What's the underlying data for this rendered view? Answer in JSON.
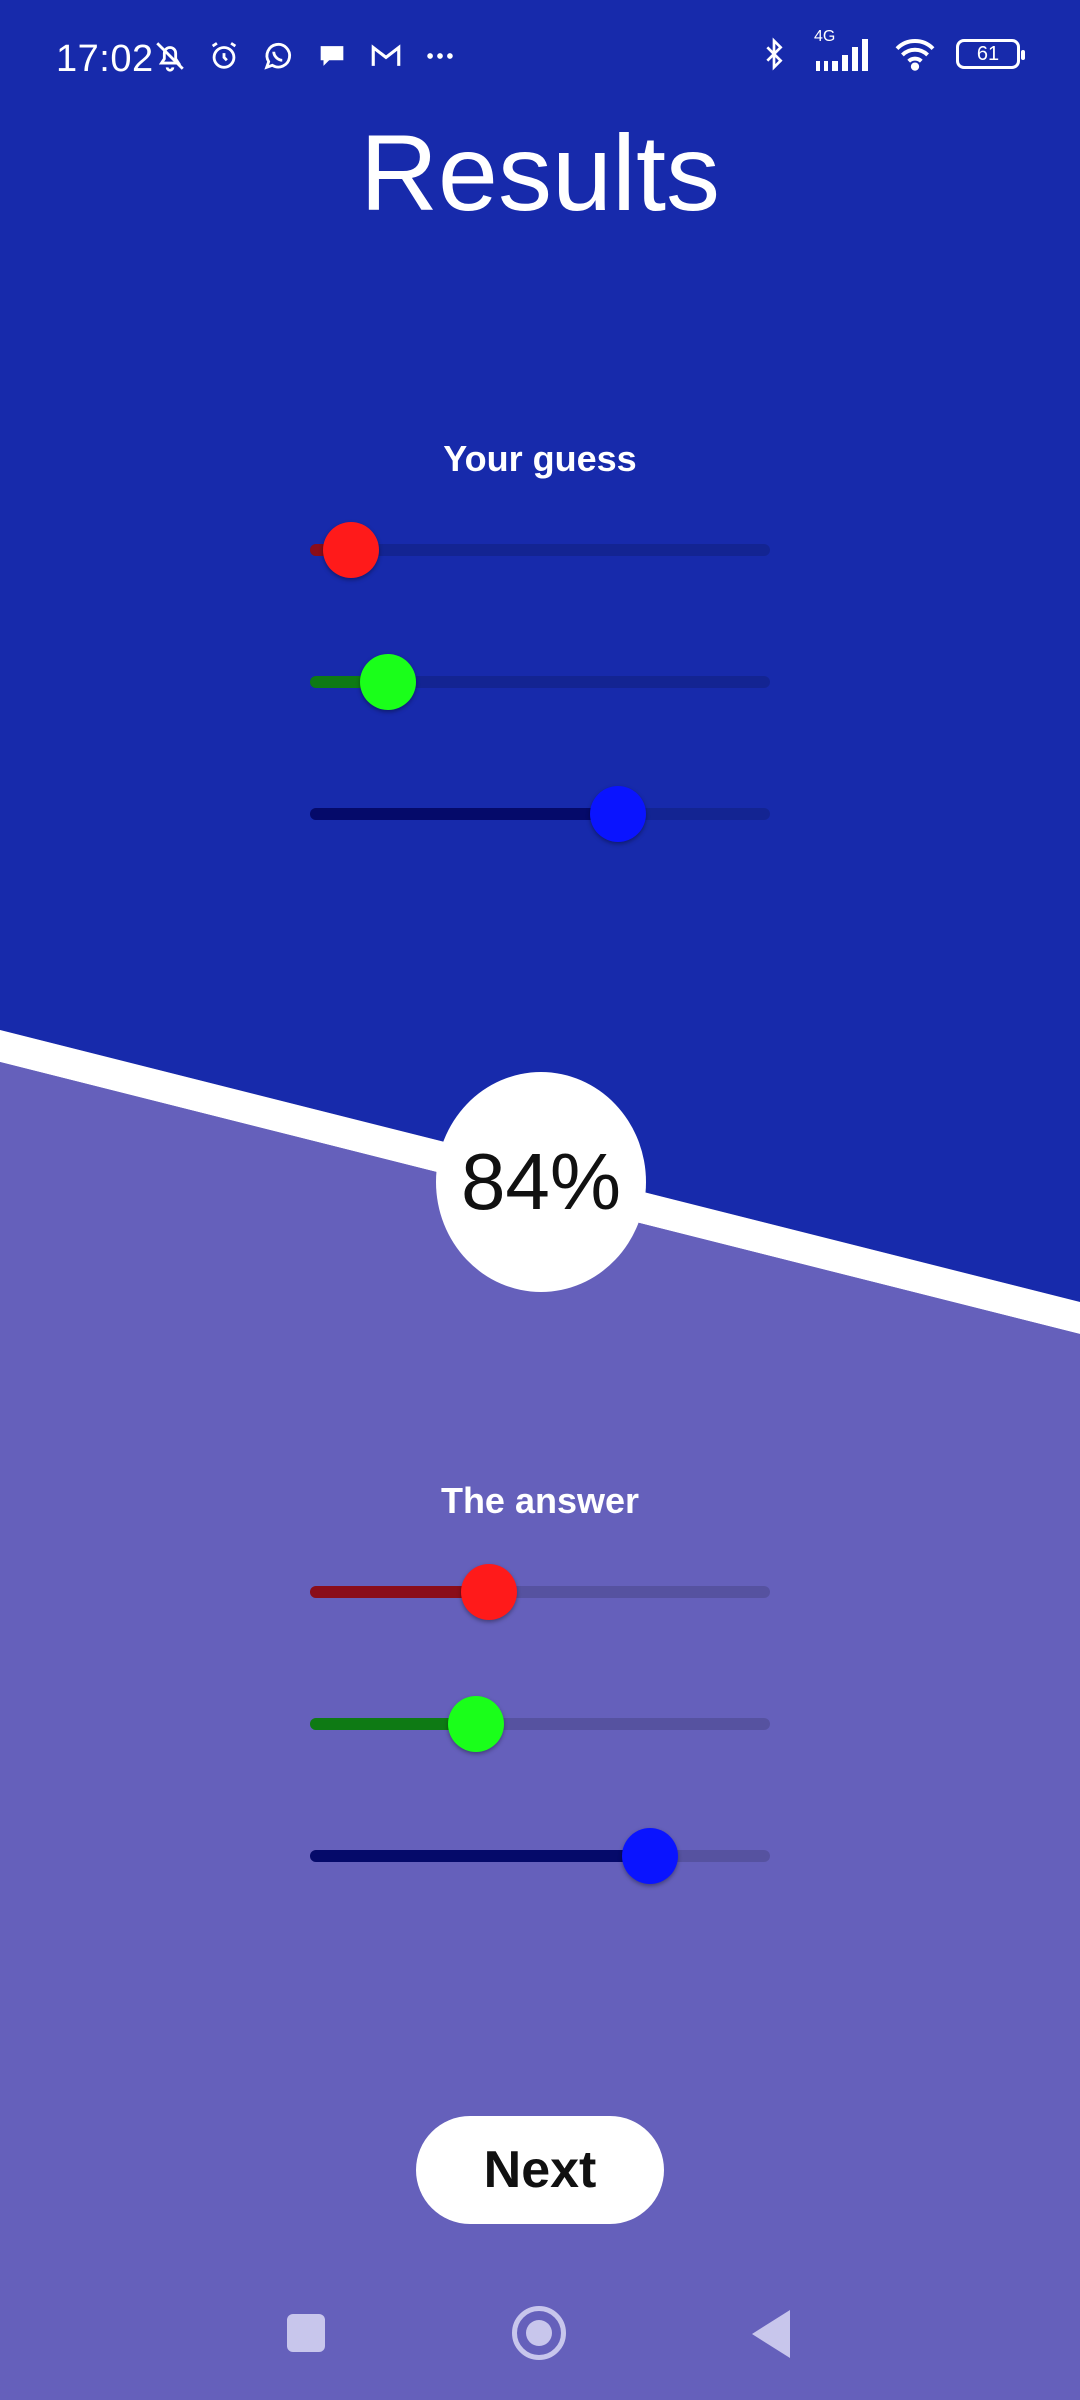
{
  "status_bar": {
    "time": "17:02",
    "network": "4G",
    "battery": "61",
    "left_icons": [
      "bell-off-icon",
      "alarm-icon",
      "whatsapp-icon",
      "chat-icon",
      "gmail-icon",
      "more-icon"
    ],
    "right_icons": [
      "bluetooth-icon",
      "signal-icon",
      "wifi-icon",
      "battery-icon"
    ]
  },
  "title": "Results",
  "guess": {
    "label": "Your guess",
    "red": 0.09,
    "green": 0.17,
    "blue": 0.67
  },
  "answer": {
    "label": "The answer",
    "red": 0.39,
    "green": 0.36,
    "blue": 0.74
  },
  "score": "84%",
  "next_label": "Next",
  "colors": {
    "top_bg": "#172aab",
    "bottom_bg": "#6560bb",
    "red_thumb": "#ff1a1a",
    "green_thumb": "#1aff1a",
    "blue_thumb": "#0a14ff",
    "red_fill": "#8a0d1a",
    "green_fill": "#0e7a14",
    "blue_fill": "#050a6a"
  }
}
